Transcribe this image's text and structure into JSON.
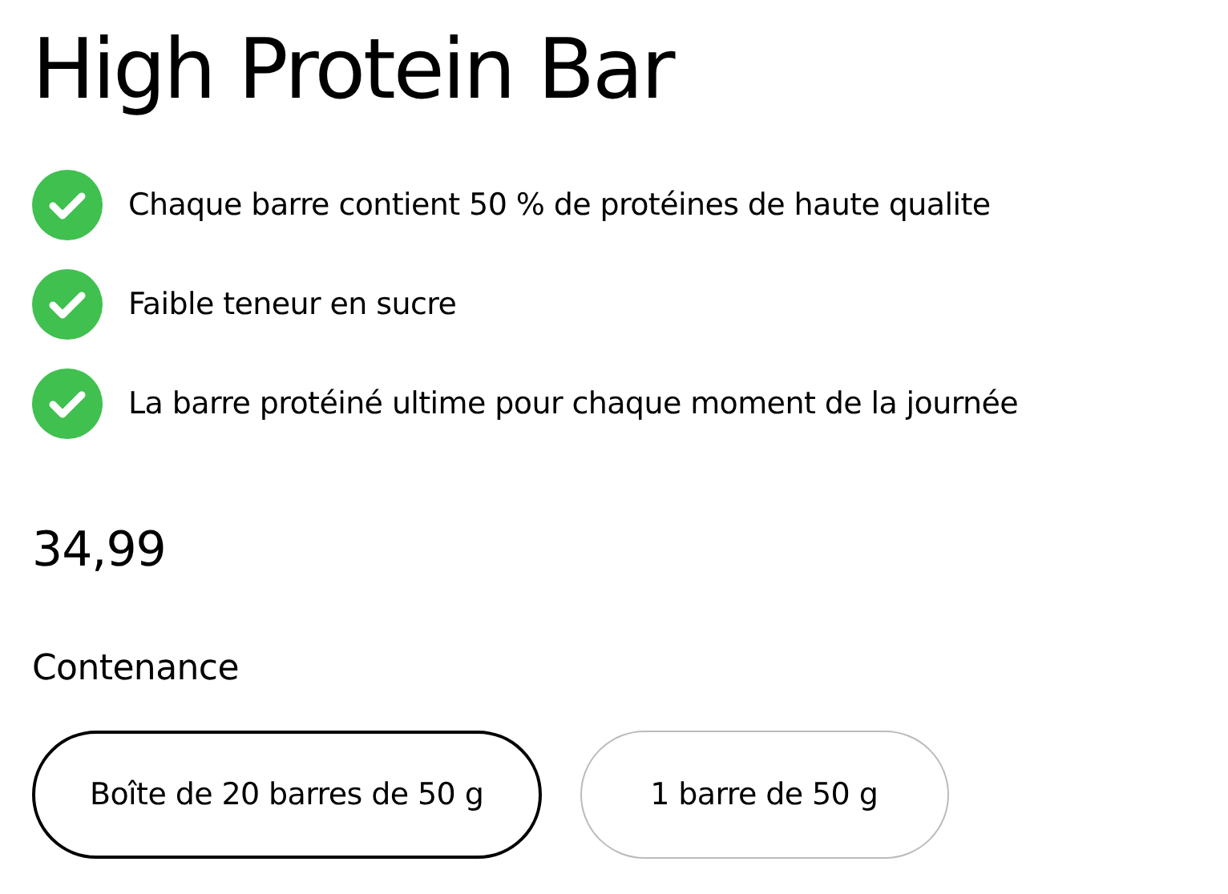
{
  "title": "High Protein Bar",
  "features": [
    {
      "text": "Chaque barre contient 50 % de protéines de haute qualite"
    },
    {
      "text": "Faible teneur en sucre"
    },
    {
      "text": "La barre protéiné ultime pour chaque moment de la journée"
    }
  ],
  "price": "34,99",
  "option_label": "Contenance",
  "options": [
    {
      "label": "Boîte de 20 barres de 50 g",
      "selected": true
    },
    {
      "label": "1 barre de 50 g",
      "selected": false
    }
  ]
}
